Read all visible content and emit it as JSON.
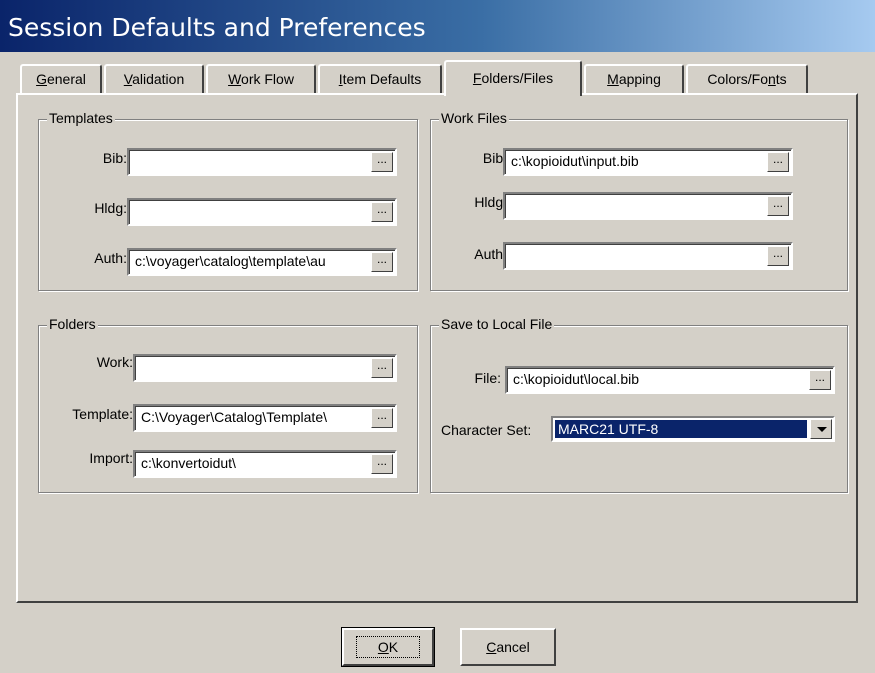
{
  "window": {
    "title": "Session Defaults and Preferences"
  },
  "tabs": [
    {
      "label_prefix": "",
      "label_mnemonic": "G",
      "label_rest": "eneral",
      "active": false
    },
    {
      "label_prefix": "",
      "label_mnemonic": "V",
      "label_rest": "alidation",
      "active": false
    },
    {
      "label_prefix": "",
      "label_mnemonic": "W",
      "label_rest": "ork Flow",
      "active": false
    },
    {
      "label_prefix": "",
      "label_mnemonic": "I",
      "label_rest": "tem Defaults",
      "active": false
    },
    {
      "label_prefix": "",
      "label_mnemonic": "F",
      "label_rest": "olders/Files",
      "active": true
    },
    {
      "label_prefix": "",
      "label_mnemonic": "M",
      "label_rest": "apping",
      "active": false
    },
    {
      "label_prefix": "Colors/Fo",
      "label_mnemonic": "n",
      "label_rest": "ts",
      "active": false
    }
  ],
  "templates": {
    "legend": "Templates",
    "bib_label": "Bib:",
    "bib_value": "",
    "hldg_label": "Hldg:",
    "hldg_value": "",
    "auth_label": "Auth:",
    "auth_value": "c:\\voyager\\catalog\\template\\au"
  },
  "work_files": {
    "legend": "Work Files",
    "bib_label": "Bib:",
    "bib_value": "c:\\kopioidut\\input.bib",
    "hldg_label": "Hldg:",
    "hldg_value": "",
    "auth_label": "Auth:",
    "auth_value": ""
  },
  "folders": {
    "legend": "Folders",
    "work_label": "Work:",
    "work_value": "",
    "template_label": "Template:",
    "template_value": "C:\\Voyager\\Catalog\\Template\\",
    "import_label": "Import:",
    "import_value": "c:\\konvertoidut\\"
  },
  "save_local": {
    "legend": "Save to Local File",
    "file_label": "File:",
    "file_value": "c:\\kopioidut\\local.bib",
    "charset_label": "Character Set:",
    "charset_value": "MARC21 UTF-8"
  },
  "browse_glyph": "...",
  "buttons": {
    "ok_mnemonic": "O",
    "ok_rest": "K",
    "cancel_mnemonic": "C",
    "cancel_rest": "ancel"
  }
}
